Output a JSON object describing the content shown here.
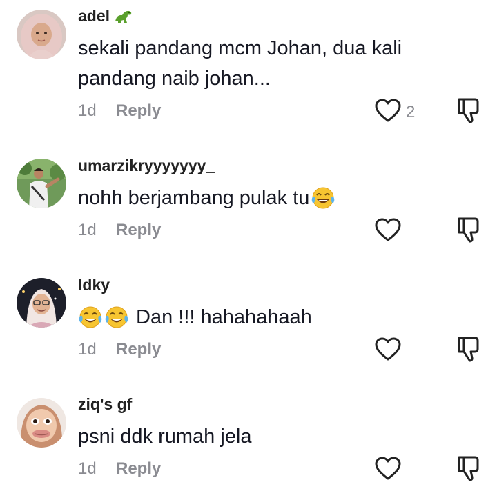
{
  "comments": [
    {
      "username": "adel",
      "badge_icon": "dinosaur-emoji",
      "text": "sekali pandang mcm Johan, dua kali pandang naib johan...",
      "time": "1d",
      "reply_label": "Reply",
      "likes": "2"
    },
    {
      "username": "umarzikryyyyyyy_",
      "text": "nohh berjambang pulak tu",
      "trailing_emoji": "face-with-tears-of-joy",
      "time": "1d",
      "reply_label": "Reply",
      "likes": ""
    },
    {
      "username": "Idky",
      "leading_emoji": [
        "face-with-tears-of-joy",
        "face-with-tears-of-joy"
      ],
      "text": "Dan !!! hahahahaah",
      "time": "1d",
      "reply_label": "Reply",
      "likes": ""
    },
    {
      "username": "ziq's gf",
      "text": "psni ddk rumah jela",
      "time": "1d",
      "reply_label": "Reply",
      "likes": ""
    }
  ],
  "icons": {
    "like": "heart-outline-icon",
    "dislike": "thumbs-down-outline-icon"
  },
  "colors": {
    "text_primary": "#161823",
    "text_secondary": "#8a8b91",
    "icon_stroke": "#222222"
  }
}
